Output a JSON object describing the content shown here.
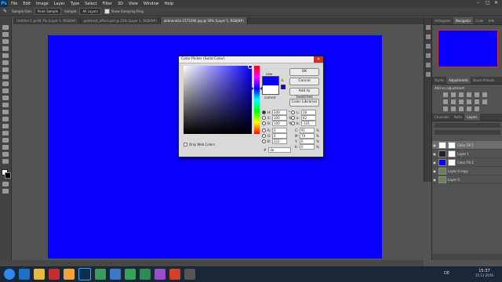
{
  "app": {
    "logo": "Ps"
  },
  "menu": [
    "File",
    "Edit",
    "Image",
    "Layer",
    "Type",
    "Select",
    "Filter",
    "3D",
    "View",
    "Window",
    "Help"
  ],
  "options": {
    "sample_size_label": "Sample Size:",
    "sample_size_value": "Point Sample",
    "sample_label": "Sample:",
    "sample_value": "All Layers",
    "show_ring_label": "Show Sampling Ring"
  },
  "tabs": [
    {
      "label": "Untitled-1 @ 66.7% (Layer 1, RGB/8#)"
    },
    {
      "label": "pinterest_effect.psd @ 25% (Layer 1, RGB/8#)"
    },
    {
      "label": "oldmonkitv-1571296.jpg @ 30% (Layer 1, RGB/8#)"
    }
  ],
  "dialog": {
    "title": "Color Picker (Solid Color)",
    "new_label": "new",
    "current_label": "current",
    "ok": "OK",
    "cancel": "Cancel",
    "add_swatches": "Add to Swatches",
    "color_libraries": "Color Libraries",
    "only_web": "Only Web Colors",
    "hsb": [
      {
        "l": "H:",
        "v": "240",
        "u": "°"
      },
      {
        "l": "S:",
        "v": "100",
        "u": "%"
      },
      {
        "l": "B:",
        "v": "100",
        "u": "%"
      }
    ],
    "rgb": [
      {
        "l": "R:",
        "v": "0",
        "u": ""
      },
      {
        "l": "G:",
        "v": "0",
        "u": ""
      },
      {
        "l": "B:",
        "v": "222",
        "u": ""
      }
    ],
    "lab": [
      {
        "l": "L:",
        "v": "28",
        "u": ""
      },
      {
        "l": "a:",
        "v": "62",
        "u": ""
      },
      {
        "l": "b:",
        "v": "-101",
        "u": ""
      }
    ],
    "cmyk": [
      {
        "l": "C:",
        "v": "91",
        "u": "%"
      },
      {
        "l": "M:",
        "v": "79",
        "u": "%"
      },
      {
        "l": "Y:",
        "v": "0",
        "u": "%"
      },
      {
        "l": "K:",
        "v": "0",
        "u": "%"
      }
    ],
    "hex_label": "#",
    "hex_value": "de"
  },
  "panels": {
    "top_tabs": [
      "Histogram",
      "Navigator",
      "Color",
      "Info"
    ],
    "adj_tabs": [
      "Styles",
      "Adjustments",
      "Brush Presets"
    ],
    "adj_title": "Add an adjustment",
    "layer_tabs": [
      "Channels",
      "Paths",
      "Layers"
    ],
    "layers": [
      "Color Fill 1",
      "Layer 1",
      "Color Fill 1",
      "Layer 0 copy",
      "Layer 0"
    ]
  },
  "taskbar": {
    "time": "15:37",
    "date": "22.11.2016",
    "lang": "DE"
  },
  "colors": {
    "canvas": "#0a00ff",
    "dialog_bg": "#d9d9d9"
  }
}
